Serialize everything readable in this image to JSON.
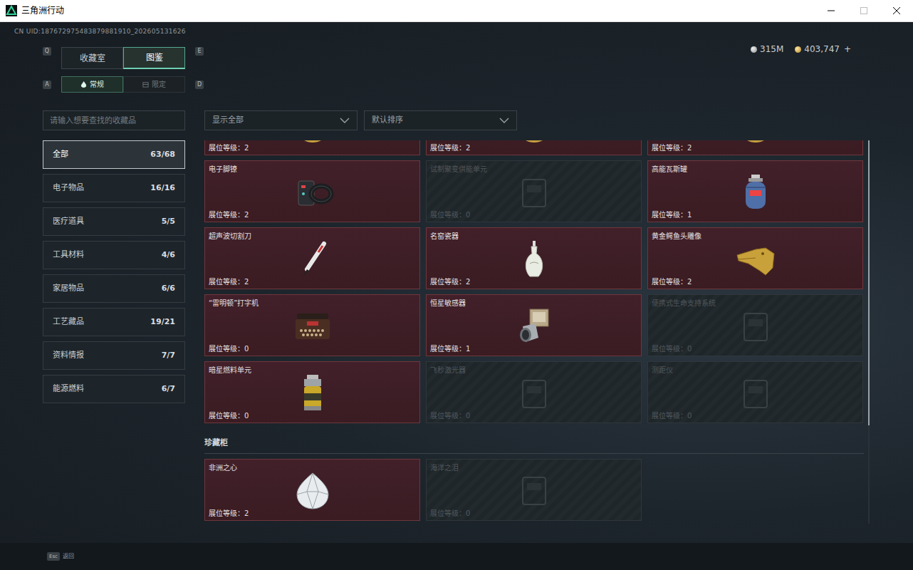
{
  "window": {
    "title": "三角洲行动"
  },
  "uid": "CN UID:187672975483879881910_202605131626",
  "currency": [
    {
      "amount": "315M",
      "kind": "silver"
    },
    {
      "amount": "403,747",
      "kind": "gold"
    }
  ],
  "currency_add": "+",
  "tabs": {
    "prev_key": "Q",
    "next_key": "E",
    "items": [
      {
        "label": "收藏室",
        "selected": false
      },
      {
        "label": "图鉴",
        "selected": true
      }
    ]
  },
  "subtabs": {
    "prev_key": "A",
    "next_key": "D",
    "items": [
      {
        "label": "常规",
        "selected": true,
        "kind": "regular"
      },
      {
        "label": "限定",
        "selected": false,
        "kind": "limited"
      }
    ]
  },
  "search": {
    "placeholder": "请输入想要查找的收藏品"
  },
  "filters": [
    {
      "label": "显示全部"
    },
    {
      "label": "默认排序"
    }
  ],
  "sidebar": {
    "items": [
      {
        "label": "全部",
        "count": "63/68",
        "selected": true
      },
      {
        "label": "电子物品",
        "count": "16/16",
        "selected": false
      },
      {
        "label": "医疗道具",
        "count": "5/5",
        "selected": false
      },
      {
        "label": "工具材料",
        "count": "4/6",
        "selected": false
      },
      {
        "label": "家居物品",
        "count": "6/6",
        "selected": false
      },
      {
        "label": "工艺藏品",
        "count": "19/21",
        "selected": false
      },
      {
        "label": "资料情报",
        "count": "7/7",
        "selected": false
      },
      {
        "label": "能源燃料",
        "count": "6/7",
        "selected": false
      }
    ]
  },
  "grid": {
    "items": [
      {
        "grade": "展位等级：2",
        "owned": true
      },
      {
        "grade": "展位等级：2",
        "owned": true
      },
      {
        "grade": "展位等级：2",
        "owned": true
      },
      {
        "name": "电子脚镣",
        "grade": "展位等级：2",
        "owned": true
      },
      {
        "name": "试制聚变供能单元",
        "grade": "展位等级：0",
        "owned": false
      },
      {
        "name": "高能瓦斯罐",
        "grade": "展位等级：1",
        "owned": true
      },
      {
        "name": "超声波切割刀",
        "grade": "展位等级：2",
        "owned": true
      },
      {
        "name": "名窑瓷器",
        "grade": "展位等级：2",
        "owned": true
      },
      {
        "name": "黄金鳄鱼头雕像",
        "grade": "展位等级：2",
        "owned": true
      },
      {
        "name": "“雷明顿”打字机",
        "grade": "展位等级：0",
        "owned": true
      },
      {
        "name": "恒星敏感器",
        "grade": "展位等级：1",
        "owned": true
      },
      {
        "name": "便携式生命支持系统",
        "grade": "展位等级：0",
        "owned": false
      },
      {
        "name": "暗星燃料单元",
        "grade": "展位等级：0",
        "owned": true
      },
      {
        "name": "飞秒激光器",
        "grade": "展位等级：0",
        "owned": false
      },
      {
        "name": "测距仪",
        "grade": "展位等级：0",
        "owned": false
      }
    ]
  },
  "showcase": {
    "title": "珍藏柜",
    "items": [
      {
        "name": "非洲之心",
        "grade": "展位等级：2",
        "owned": true
      },
      {
        "name": "海洋之泪",
        "grade": "展位等级：0",
        "owned": false
      }
    ]
  },
  "footer": {
    "key": "Esc",
    "label": "返回"
  }
}
